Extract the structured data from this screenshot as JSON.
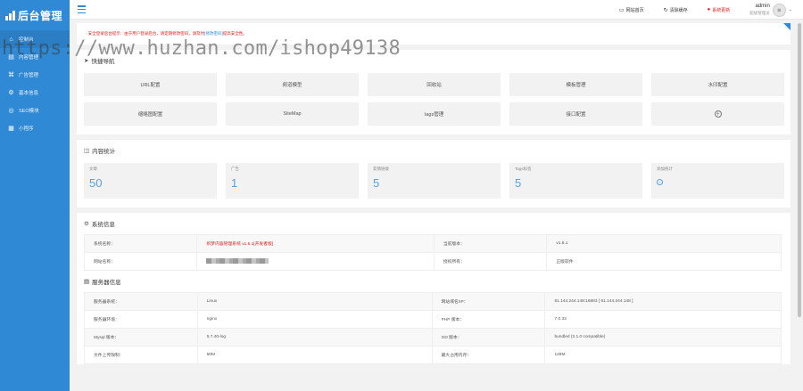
{
  "app": {
    "logo_text": "后台管理"
  },
  "sidebar": {
    "items": [
      {
        "label": "控制台",
        "icon": "home-icon"
      },
      {
        "label": "内容管理",
        "icon": "document-icon"
      },
      {
        "label": "广告管理",
        "icon": "advertisement-icon"
      },
      {
        "label": "基本信息",
        "icon": "gear-icon"
      },
      {
        "label": "SEO模块",
        "icon": "seo-icon"
      },
      {
        "label": "小程序",
        "icon": "grid-icon"
      }
    ]
  },
  "topbar": {
    "site_home": "网站首页",
    "clear_cache": "清除缓存",
    "system_update": "系统更新",
    "user_name": "admin",
    "user_role": "超级管理员"
  },
  "notice": {
    "text_before": "· 安全登录后台提示：由于用户登录后台，请定期修改密码，请及时",
    "link": "[修改密码]",
    "text_after": "提高安全性。"
  },
  "quick_nav": {
    "title": "快捷导航",
    "items": [
      "URL配置",
      "频道模型",
      "回收站",
      "模板管理",
      "水印配置",
      "缩略图配置",
      "SiteMap",
      "tags管理",
      "接口配置"
    ]
  },
  "stats": {
    "title": "内容统计",
    "items": [
      {
        "label": "文章",
        "value": "50"
      },
      {
        "label": "广告",
        "value": "1"
      },
      {
        "label": "友情链接",
        "value": "5"
      },
      {
        "label": "Tags标签",
        "value": "5"
      },
      {
        "label": "添加统计",
        "value": ""
      }
    ]
  },
  "system_info": {
    "title": "系统信息",
    "rows": [
      [
        "系统名称：",
        "织梦内容管理系统 v1.6.1[开发者版]",
        "当前版本：",
        "v1.6.1"
      ],
      [
        "网站名称：",
        "",
        "授权所有：",
        "正版软件"
      ]
    ]
  },
  "server_info": {
    "title": "服务器信息",
    "rows": [
      [
        "服务器系统：",
        "Linux",
        "网站域名/IP：",
        "61.144.244.148:16883 [ 61.144.244.148 ]"
      ],
      [
        "服务器环境：",
        "nginx",
        "PHP 版本：",
        "7.0.33"
      ],
      [
        "Mysql 版本：",
        "5.7.40-log",
        "GD 版本：",
        "bundled (2.1.0 compatible)"
      ],
      [
        "文件上传限制：",
        "50M",
        "最大占用内存：",
        "128M"
      ]
    ]
  },
  "watermark": "https://www.huzhan.com/ishop49138",
  "colors": {
    "sidebar": "#2f89d4",
    "accent": "#2f89d4",
    "alert": "#e02020",
    "stat_value": "#5d9fd7"
  }
}
